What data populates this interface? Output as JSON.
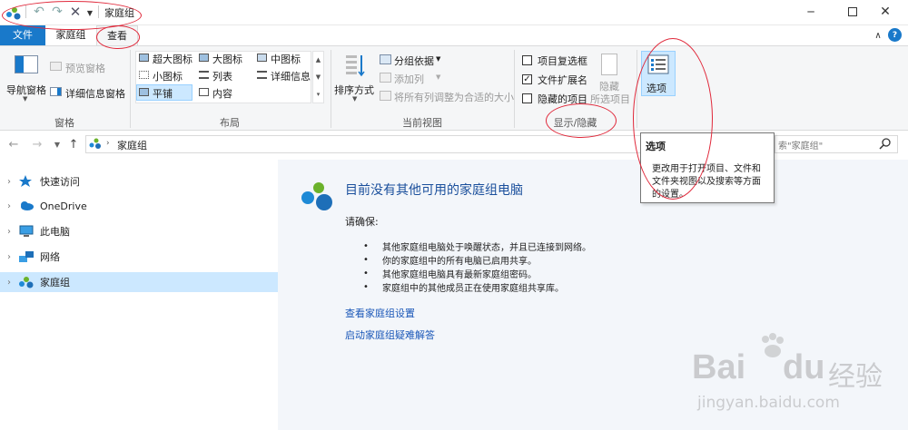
{
  "window": {
    "title": "家庭组"
  },
  "tabs": [
    "文件",
    "家庭组",
    "查看"
  ],
  "ribbon": {
    "panes": {
      "nav_pane": "导航窗格",
      "preview_pane": "预览窗格",
      "details_pane": "详细信息窗格",
      "group": "窗格"
    },
    "layout": {
      "xlarge_icons": "超大图标",
      "large_icons": "大图标",
      "medium_icons": "中图标",
      "small_icons": "小图标",
      "list": "列表",
      "details": "详细信息",
      "tiles": "平铺",
      "content": "内容",
      "group": "布局"
    },
    "current_view": {
      "sort_by": "排序方式",
      "group_by": "分组依据",
      "add_columns": "添加列",
      "size_all_columns": "将所有列调整为合适的大小",
      "group": "当前视图"
    },
    "show_hide": {
      "item_checkboxes": "项目复选框",
      "file_extensions": "文件扩展名",
      "hidden_items": "隐藏的项目",
      "hide": "隐藏",
      "selected_items": "所选项目",
      "group": "显示/隐藏",
      "item_checkboxes_checked": false,
      "file_extensions_checked": true,
      "hidden_items_checked": false
    },
    "options": {
      "label": "选项"
    }
  },
  "address": {
    "crumb": "家庭组",
    "search_placeholder": "索\"家庭组\""
  },
  "tooltip": {
    "title": "选项",
    "body_line1": "更改用于打开项目、文件和",
    "body_line2": "文件夹视图以及搜索等方面",
    "body_line3": "的设置。"
  },
  "nav": [
    {
      "label": "快速访问",
      "icon": "star-icon"
    },
    {
      "label": "OneDrive",
      "icon": "cloud-icon"
    },
    {
      "label": "此电脑",
      "icon": "computer-icon"
    },
    {
      "label": "网络",
      "icon": "network-icon"
    },
    {
      "label": "家庭组",
      "icon": "homegroup-icon",
      "selected": true
    }
  ],
  "content": {
    "heading": "目前没有其他可用的家庭组电脑",
    "ensure": "请确保:",
    "bullets": [
      "其他家庭组电脑处于唤醒状态，并且已连接到网络。",
      "你的家庭组中的所有电脑已启用共享。",
      "其他家庭组电脑具有最新家庭组密码。",
      "家庭组中的其他成员正在使用家庭组共享库。"
    ],
    "link_settings": "查看家庭组设置",
    "link_troubleshoot": "启动家庭组疑难解答"
  },
  "watermark": {
    "brand": "Bai",
    "brand2": "du",
    "cn": "经验",
    "url": "jingyan.baidu.com"
  },
  "colors": {
    "accent": "#1979ca",
    "link": "#1a57b8",
    "annotation": "#e0283a",
    "selection": "#cce8ff"
  }
}
